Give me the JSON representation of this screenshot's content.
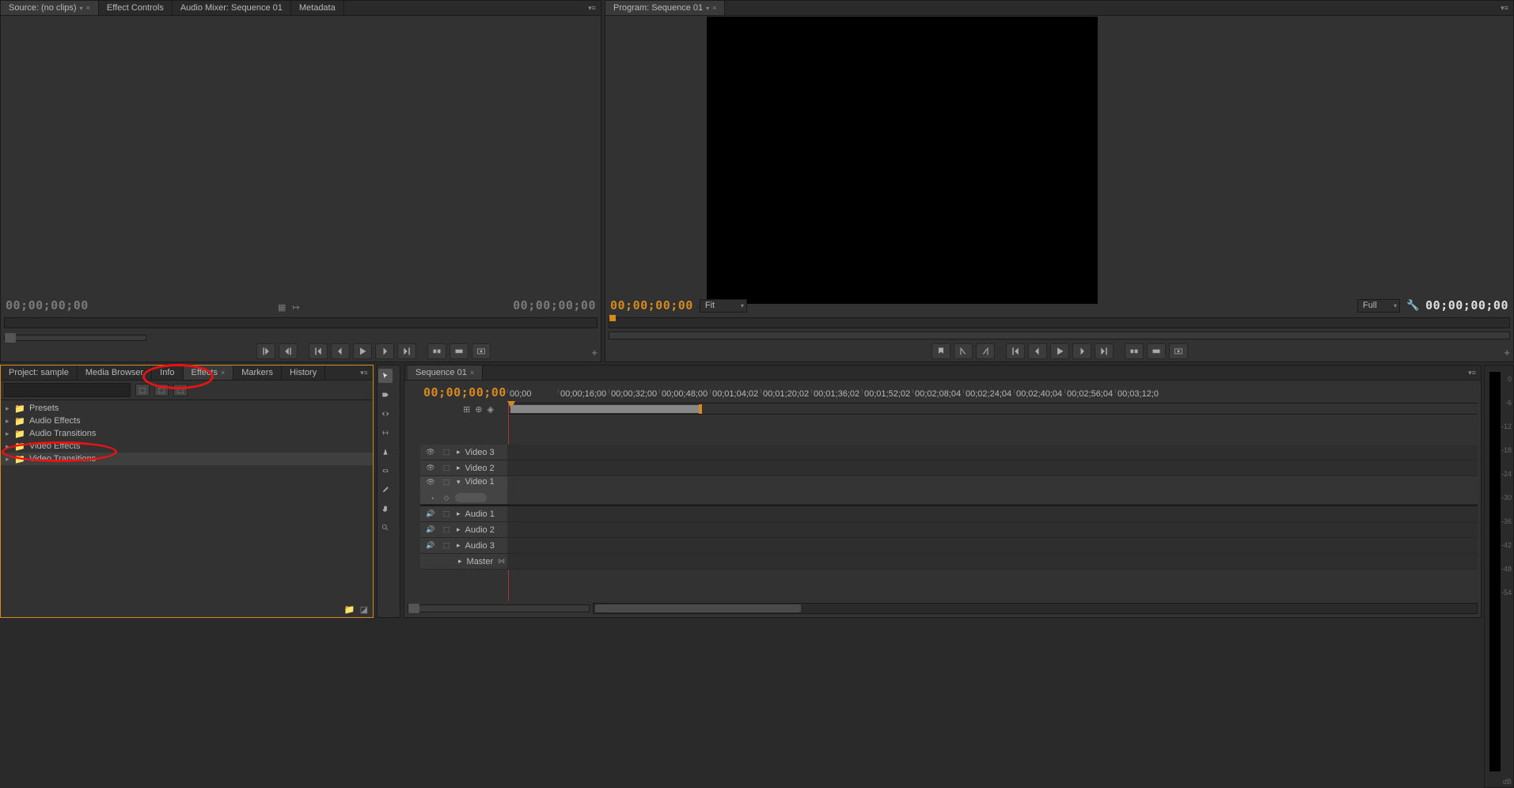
{
  "source_panel": {
    "tabs": [
      {
        "label": "Source: (no clips)",
        "active": true,
        "dropdown": true,
        "close": true
      },
      {
        "label": "Effect Controls"
      },
      {
        "label": "Audio Mixer: Sequence 01"
      },
      {
        "label": "Metadata"
      }
    ],
    "timecode_left": "00;00;00;00",
    "timecode_right": "00;00;00;00"
  },
  "program_panel": {
    "tab": "Program: Sequence 01",
    "timecode_left": "00;00;00;00",
    "timecode_right": "00;00;00;00",
    "zoom": "Fit",
    "quality": "Full"
  },
  "project_panel": {
    "tabs": [
      {
        "label": "Project: sample"
      },
      {
        "label": "Media Browser"
      },
      {
        "label": "Info"
      },
      {
        "label": "Effects",
        "active": true,
        "close": true
      },
      {
        "label": "Markers"
      },
      {
        "label": "History"
      }
    ],
    "search_placeholder": "",
    "tree": [
      {
        "label": "Presets"
      },
      {
        "label": "Audio Effects"
      },
      {
        "label": "Audio Transitions"
      },
      {
        "label": "Video Effects"
      },
      {
        "label": "Video Transitions",
        "selected": true
      }
    ]
  },
  "timeline": {
    "tab": "Sequence 01",
    "timecode": "00;00;00;00",
    "ruler": [
      "00;00",
      "00;00;16;00",
      "00;00;32;00",
      "00;00;48;00",
      "00;01;04;02",
      "00;01;20;02",
      "00;01;36;02",
      "00;01;52;02",
      "00;02;08;04",
      "00;02;24;04",
      "00;02;40;04",
      "00;02;56;04",
      "00;03;12;0"
    ],
    "video_tracks": [
      {
        "label": "Video 3"
      },
      {
        "label": "Video 2"
      },
      {
        "label": "Video 1",
        "expanded": true
      }
    ],
    "audio_tracks": [
      {
        "label": "Audio 1"
      },
      {
        "label": "Audio 2"
      },
      {
        "label": "Audio 3"
      },
      {
        "label": "Master",
        "master": true
      }
    ]
  },
  "audio_meter": {
    "scale": [
      "0",
      "-6",
      "-12",
      "-18",
      "-24",
      "-30",
      "-36",
      "-42",
      "-48",
      "-54"
    ],
    "unit": "dB"
  }
}
